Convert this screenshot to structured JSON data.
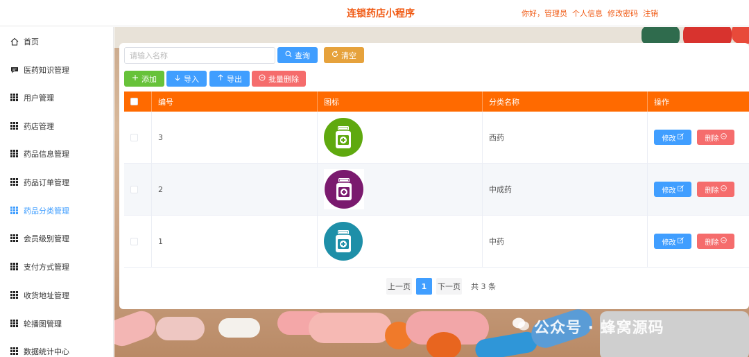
{
  "header": {
    "title": "连锁药店小程序",
    "greeting": "你好，管理员",
    "profile": "个人信息",
    "change_password": "修改密码",
    "logout": "注销",
    "accent_color": "#f05a14"
  },
  "sidebar": {
    "items": [
      {
        "label": "首页",
        "icon": "home-icon"
      },
      {
        "label": "医药知识管理",
        "icon": "chat-icon"
      },
      {
        "label": "用户管理",
        "icon": "grid-icon"
      },
      {
        "label": "药店管理",
        "icon": "grid-icon"
      },
      {
        "label": "药品信息管理",
        "icon": "grid-icon"
      },
      {
        "label": "药品订单管理",
        "icon": "grid-icon"
      },
      {
        "label": "药品分类管理",
        "icon": "grid-icon",
        "active": true
      },
      {
        "label": "会员级别管理",
        "icon": "grid-icon"
      },
      {
        "label": "支付方式管理",
        "icon": "grid-icon"
      },
      {
        "label": "收货地址管理",
        "icon": "grid-icon"
      },
      {
        "label": "轮播图管理",
        "icon": "grid-icon"
      },
      {
        "label": "数据统计中心",
        "icon": "grid-icon"
      }
    ]
  },
  "search": {
    "placeholder": "请输入名称",
    "value": "",
    "query_label": "查询",
    "clear_label": "清空"
  },
  "toolbar": {
    "add_label": "添加",
    "import_label": "导入",
    "export_label": "导出",
    "batch_delete_label": "批量删除"
  },
  "table": {
    "header_color": "#ff6a00",
    "columns": [
      "编号",
      "图标",
      "分类名称",
      "操作"
    ],
    "rows": [
      {
        "id": "3",
        "name": "西药",
        "icon_color": "#5fa90f"
      },
      {
        "id": "2",
        "name": "中成药",
        "icon_color": "#7a1a6e"
      },
      {
        "id": "1",
        "name": "中药",
        "icon_color": "#1e8fa8"
      }
    ],
    "edit_label": "修改",
    "delete_label": "删除"
  },
  "pagination": {
    "prev_label": "上一页",
    "current_page": "1",
    "next_label": "下一页",
    "total_label": "共 3 条"
  },
  "watermark": "公众号 · 蜂窝源码"
}
